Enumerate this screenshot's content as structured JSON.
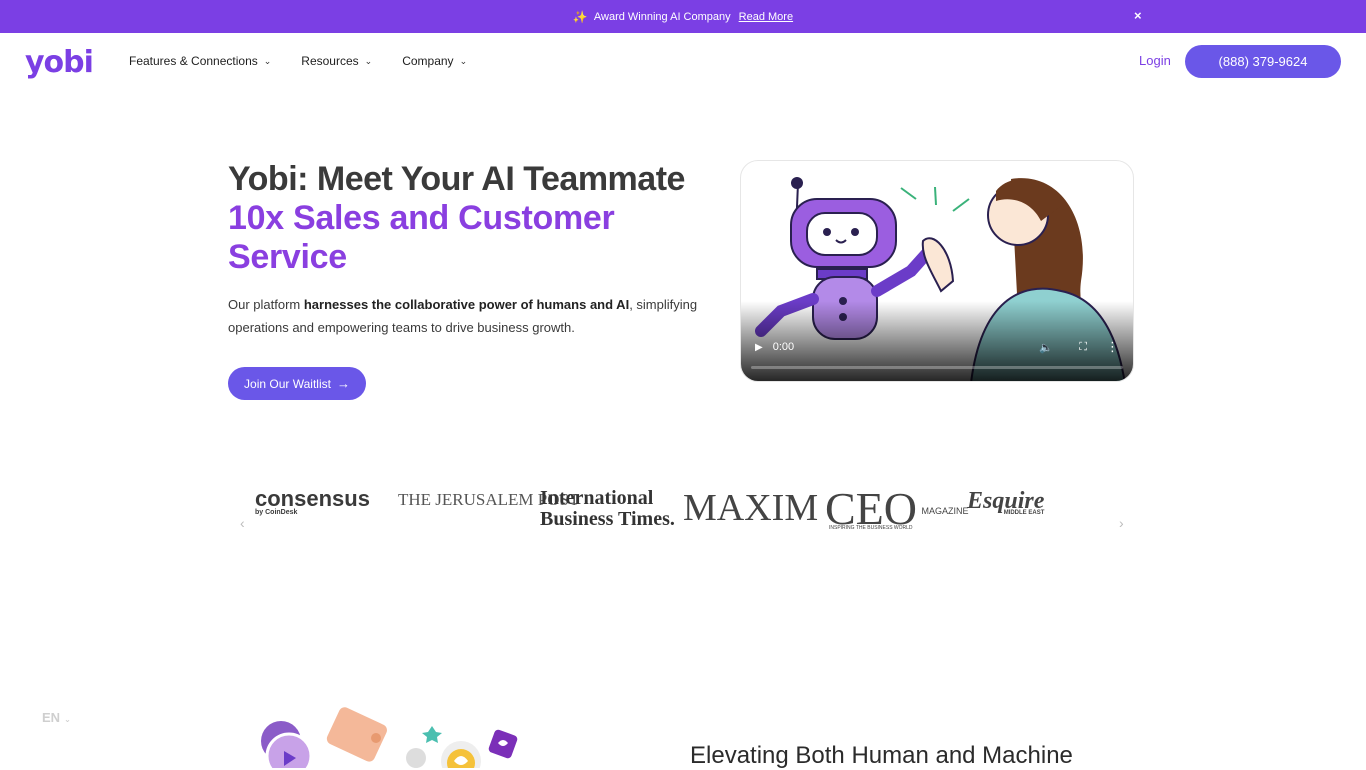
{
  "announcement": {
    "text": "Award Winning AI Company",
    "link": "Read More",
    "close": "×"
  },
  "nav": {
    "logo": "yobi",
    "menu": [
      "Features & Connections",
      "Resources",
      "Company"
    ],
    "login": "Login",
    "phone": "(888) 379-9624"
  },
  "hero": {
    "title": "Yobi: Meet Your AI Teammate",
    "subtitle": "10x Sales and Customer Service",
    "desc_prefix": "Our platform ",
    "desc_bold": "harnesses the collaborative power of humans and AI",
    "desc_suffix": ", simplifying operations and empowering teams to drive business growth.",
    "cta": "Join Our Waitlist"
  },
  "video": {
    "time": "0:00"
  },
  "press_logos": [
    "consensus",
    "by CoinDesk",
    "THE JERUSALEM POST",
    "International Business Times.",
    "MAXIM",
    "CEO",
    "MAGAZINE",
    "INSPIRING THE BUSINESS WORLD",
    "Esquire",
    "MIDDLE EAST"
  ],
  "language": "EN",
  "section": {
    "title": "Elevating Both Human and Machine"
  },
  "colors": {
    "brand": "#7b3fe4",
    "button": "#6a57e8",
    "accent_text": "#8a3fe0"
  }
}
